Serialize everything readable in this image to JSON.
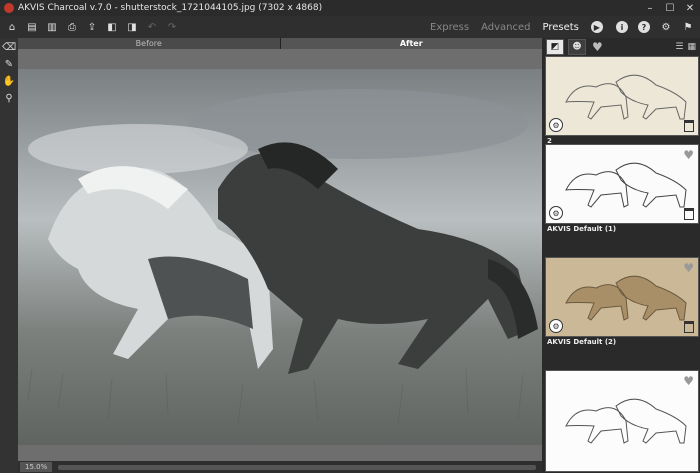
{
  "window": {
    "title": "AKVIS Charcoal v.7.0 - shutterstock_1721044105.jpg (7302 x 4868)",
    "controls": [
      "–",
      "☐",
      "✕"
    ]
  },
  "toolbar": {
    "modes": [
      "Express",
      "Advanced",
      "Presets"
    ],
    "active_mode": "Presets"
  },
  "tabs": {
    "before": "Before",
    "after": "After"
  },
  "status": {
    "zoom": "15.0%"
  },
  "presets": [
    {
      "name": "2",
      "tone": "#ece7d6"
    },
    {
      "name": "AKVIS Default (1)",
      "tone": "#fbfbfb"
    },
    {
      "name": "AKVIS Default (2)",
      "tone": "#cbb896"
    },
    {
      "name": "",
      "tone": "#fcfcfc"
    }
  ],
  "colors": {
    "accent": "#e8e8e8",
    "panel": "#2a2a2a"
  }
}
